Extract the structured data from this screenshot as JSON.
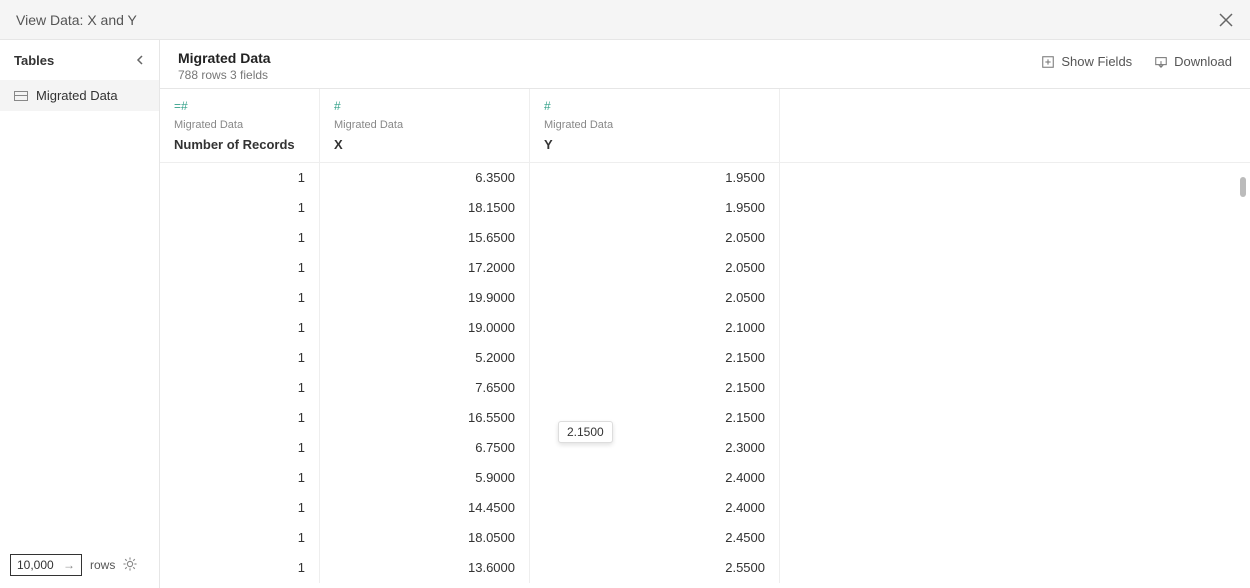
{
  "titlebar": {
    "title": "View Data: X and Y"
  },
  "sidebar": {
    "header": "Tables",
    "items": [
      {
        "label": "Migrated Data"
      }
    ]
  },
  "footer": {
    "rows_value": "10,000",
    "rows_label": "rows"
  },
  "main_header": {
    "title": "Migrated Data",
    "subtitle": "788 rows  3 fields",
    "show_fields": "Show Fields",
    "download": "Download"
  },
  "columns": [
    {
      "type_glyph": "=#",
      "src": "Migrated Data",
      "name": "Number of Records"
    },
    {
      "type_glyph": "#",
      "src": "Migrated Data",
      "name": "X"
    },
    {
      "type_glyph": "#",
      "src": "Migrated Data",
      "name": "Y"
    }
  ],
  "tooltip": "2.1500",
  "rows": [
    {
      "n": "1",
      "x": "6.3500",
      "y": "1.9500"
    },
    {
      "n": "1",
      "x": "18.1500",
      "y": "1.9500"
    },
    {
      "n": "1",
      "x": "15.6500",
      "y": "2.0500"
    },
    {
      "n": "1",
      "x": "17.2000",
      "y": "2.0500"
    },
    {
      "n": "1",
      "x": "19.9000",
      "y": "2.0500"
    },
    {
      "n": "1",
      "x": "19.0000",
      "y": "2.1000"
    },
    {
      "n": "1",
      "x": "5.2000",
      "y": "2.1500"
    },
    {
      "n": "1",
      "x": "7.6500",
      "y": "2.1500"
    },
    {
      "n": "1",
      "x": "16.5500",
      "y": "2.1500"
    },
    {
      "n": "1",
      "x": "6.7500",
      "y": "2.3000"
    },
    {
      "n": "1",
      "x": "5.9000",
      "y": "2.4000"
    },
    {
      "n": "1",
      "x": "14.4500",
      "y": "2.4000"
    },
    {
      "n": "1",
      "x": "18.0500",
      "y": "2.4500"
    },
    {
      "n": "1",
      "x": "13.6000",
      "y": "2.5500"
    }
  ]
}
